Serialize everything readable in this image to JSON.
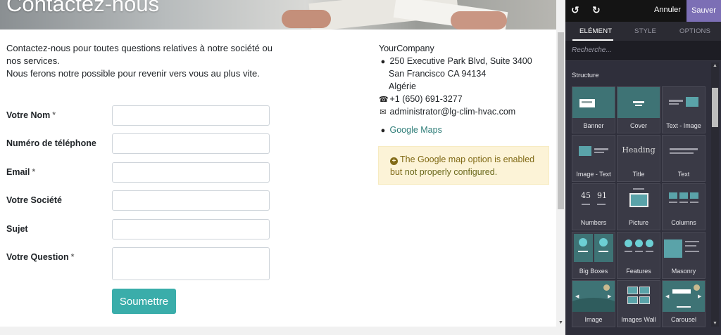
{
  "hero": {
    "title": "Contactez-nous"
  },
  "intro": {
    "line1": "Contactez-nous pour toutes questions relatives à notre société ou nos services.",
    "line2": "Nous ferons notre possible pour revenir vers vous au plus vite."
  },
  "form": {
    "fields": [
      {
        "label": "Votre Nom",
        "required": "*"
      },
      {
        "label": "Numéro de téléphone",
        "required": ""
      },
      {
        "label": "Email",
        "required": "*"
      },
      {
        "label": "Votre Société",
        "required": ""
      },
      {
        "label": "Sujet",
        "required": ""
      },
      {
        "label": "Votre Question",
        "required": "*"
      }
    ],
    "submit_label": "Soumettre"
  },
  "company": {
    "name": "YourCompany",
    "address1": "250 Executive Park Blvd, Suite 3400",
    "address2": "San Francisco CA 94134",
    "address3": "Algérie",
    "phone": "+1 (650) 691-3277",
    "email": "administrator@lg-clim-hvac.com",
    "maps_link": "Google Maps"
  },
  "alert": {
    "text1": "The Google map option is enabled",
    "text2_prefix": "but ",
    "text2_link": "not properly configured."
  },
  "editor": {
    "cancel_label": "Annuler",
    "save_label": "Sauver",
    "tabs": [
      "ELÉMENT",
      "STYLE",
      "OPTIONS"
    ],
    "search_placeholder": "Recherche...",
    "section_title": "Structure",
    "blocks": [
      "Banner",
      "Cover",
      "Text - Image",
      "Image - Text",
      "Title",
      "Text",
      "Numbers",
      "Picture",
      "Columns",
      "Big Boxes",
      "Features",
      "Masonry",
      "Image",
      "Images Wall",
      "Carousel"
    ],
    "title_thumb": "Heading",
    "numbers_thumb": [
      "45",
      "91"
    ]
  },
  "colors": {
    "accent": "#3aadaa",
    "save_button": "#7c6fb5",
    "panel_bg": "#2f2f3b",
    "alert_bg": "#fcf3d7",
    "link": "#2e7d78"
  },
  "icons": {
    "undo": "undo-icon",
    "redo": "redo-icon",
    "marker": "map-marker-icon",
    "phone": "phone-icon",
    "envelope": "envelope-icon",
    "plus": "plus-circle-icon"
  }
}
